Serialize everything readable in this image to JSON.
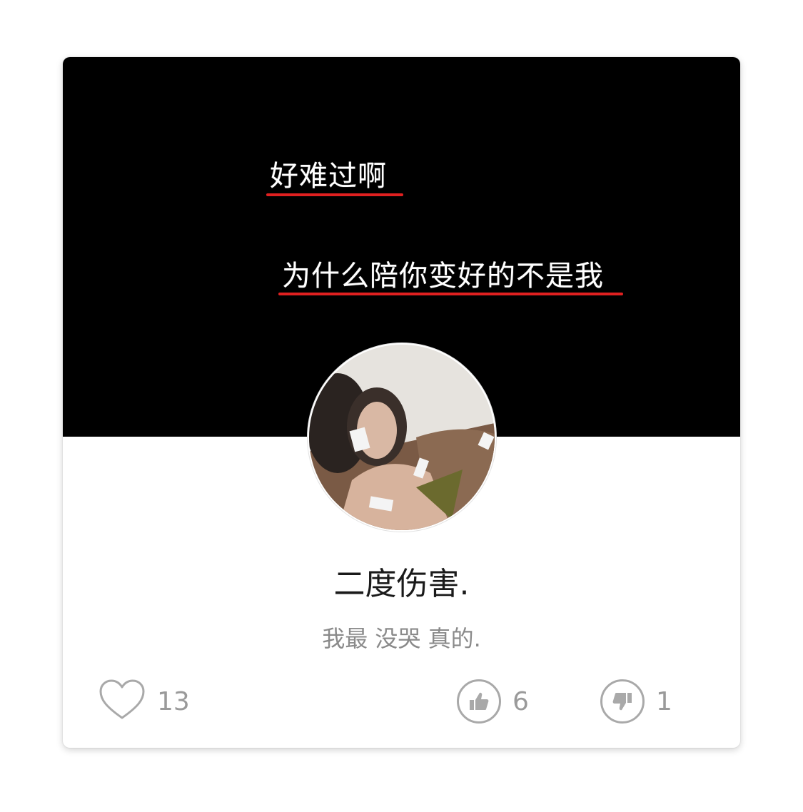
{
  "cover": {
    "lines": [
      "好难过啊",
      "为什么陪你变好的不是我"
    ],
    "background_color": "#000000",
    "text_color": "#ffffff",
    "underline_color": "#e02020"
  },
  "profile": {
    "name": "二度伤害.",
    "bio": "我最 没哭 真的."
  },
  "actions": {
    "like_icon": "heart-icon",
    "like_count": "13",
    "thumbs_up_icon": "thumbs-up-icon",
    "thumbs_up_count": "6",
    "thumbs_down_icon": "thumbs-down-icon",
    "thumbs_down_count": "1"
  },
  "colors": {
    "icon_gray": "#a9a9a9",
    "count_gray": "#9a9a9a"
  }
}
